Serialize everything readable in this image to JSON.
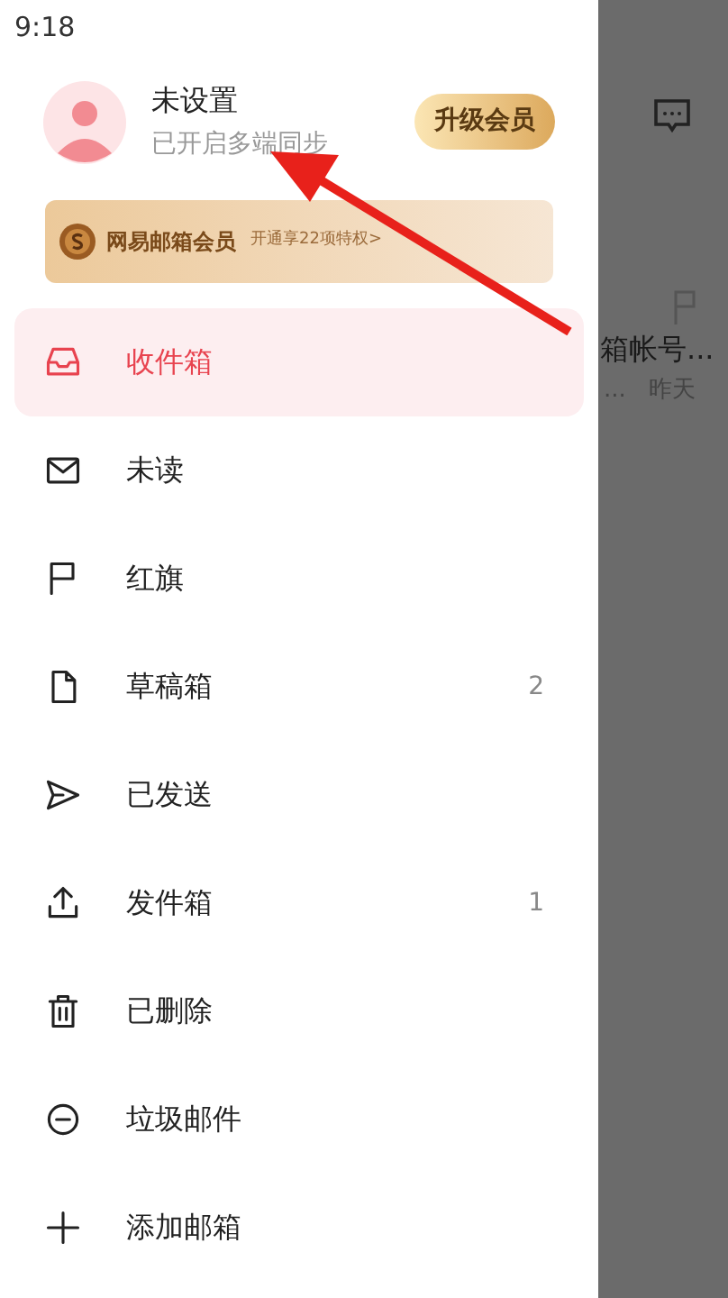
{
  "status_bar": {
    "time": "9:18"
  },
  "profile": {
    "name": "未设置",
    "subtitle": "已开启多端同步",
    "upgrade_button": "升级会员"
  },
  "vip_banner": {
    "title": "网易邮箱会员",
    "offer": "开通享22项特权>"
  },
  "folders": [
    {
      "label": "收件箱",
      "selected": true
    },
    {
      "label": "未读",
      "selected": false
    },
    {
      "label": "红旗",
      "selected": false
    },
    {
      "label": "草稿箱",
      "count": "2",
      "selected": false
    },
    {
      "label": "已发送",
      "selected": false
    },
    {
      "label": "发件箱",
      "count": "1",
      "selected": false
    },
    {
      "label": "已删除",
      "selected": false
    },
    {
      "label": "垃圾邮件",
      "selected": false
    },
    {
      "label": "添加邮箱",
      "selected": false
    }
  ],
  "background_list": {
    "subject": "箱帐号...",
    "preview": "...",
    "date": "昨天"
  }
}
